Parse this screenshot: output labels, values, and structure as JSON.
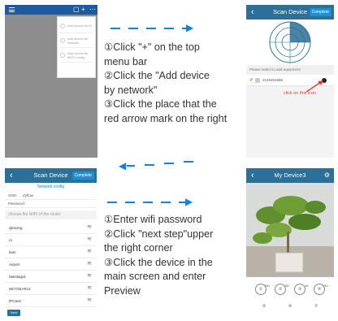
{
  "phone1": {
    "menu_items": [
      "Add device by ID",
      "Add device by network",
      "Add device by Wi-Fi config"
    ]
  },
  "instructions_top": {
    "lines": [
      "①Click \"+\" on the top",
      "menu bar",
      "②Click the \"Add device",
      "by network\"",
      "③Click the place that the",
      "red arrow mark on the right"
    ]
  },
  "phone2": {
    "title": "Scan Device",
    "complete": "Complete",
    "select_hint": "Please select to add equipment",
    "device_id": "3145451686",
    "note": "click on this icon"
  },
  "phone3": {
    "title": "Scan Device",
    "complete": "Complete",
    "section_title": "Network config",
    "ssid_label": "SSID",
    "ssid_value": "Zyflow",
    "password_label": "Password",
    "choose_hint": "choose the WIFI of the router",
    "wifi_list": [
      "sjlesong",
      "ro",
      "kam",
      "Airport",
      "Mazdaguli",
      "NETGEAR12",
      "IPCtest"
    ],
    "next_btn": "Next"
  },
  "instructions_bottom": {
    "lines": [
      "①Enter wifi password",
      "②Click \"next step\"upper",
      "the right corner",
      "③Click the device in the",
      "main screen and enter",
      "Preview"
    ]
  },
  "phone4": {
    "title": "My Device3",
    "controls_top": [
      {
        "label": "①",
        "sup": "HD"
      },
      {
        "label": "②",
        "sup": "SD"
      },
      {
        "label": "③",
        "sup": "4K"
      },
      {
        "label": "④",
        "sup": "HD"
      }
    ],
    "controls_bottom": [
      "⑤",
      "⑥",
      "⑦"
    ]
  },
  "colors": {
    "accent": "#1a7fd6",
    "header": "#2c6f97",
    "warning": "#e53935"
  }
}
